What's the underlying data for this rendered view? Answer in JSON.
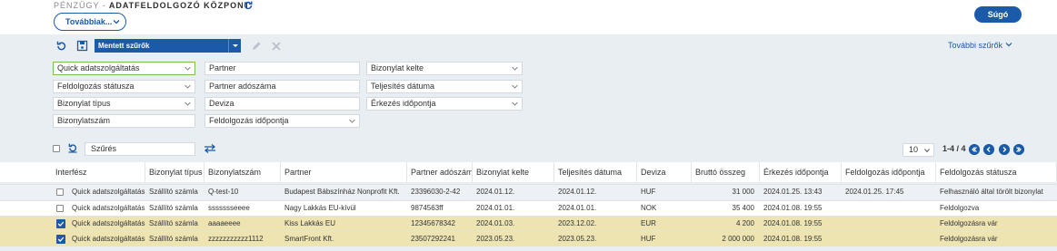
{
  "header": {
    "breadcrumb_section": "PÉNZÜGY -",
    "breadcrumb_page": "ADATFELDOLGOZÓ KÖZPONT",
    "more_button": "Továbbiak...",
    "help_button": "Súgó"
  },
  "filter_bar": {
    "saved_filter": "Mentett szűrők",
    "further_filters": "További szűrők"
  },
  "filters": {
    "quick": "Quick adatszolgáltatás",
    "processing_status": "Feldolgozás státusza",
    "doc_type": "Bizonylat típus",
    "doc_number": "Bizonylatszám",
    "partner": "Partner",
    "partner_tax": "Partner adószáma",
    "currency": "Deviza",
    "processing_time": "Feldolgozás időpontja",
    "doc_date": "Bizonylat kelte",
    "fulfil_date": "Teljesítés dátuma",
    "arrival_time": "Érkezés időpontja"
  },
  "table_toolbar": {
    "search_value": "Szűrés",
    "page_size": "10",
    "page_info": "1-4 / 4"
  },
  "columns": [
    "Interfész",
    "Bizonylat típus",
    "Bizonylatszám",
    "Partner",
    "Partner adószáma",
    "Bizonylat kelte",
    "Teljesítés dátuma",
    "Deviza",
    "Bruttó összeg",
    "Érkezés időpontja",
    "Feldolgozás időpontja",
    "Feldolgozás státusza"
  ],
  "rows": [
    {
      "checked": false,
      "interface": "Quick adatszolgáltatás",
      "type": "Szállító számla",
      "number": "Q-test-10",
      "partner": "Budapest Bábszínház Nonprofit Kft.",
      "tax": "23396030-2-42",
      "doc_date": "2024.01.12.",
      "fulfil": "2024.01.12.",
      "currency": "HUF",
      "gross": "31 000",
      "arrival": "2024.01.25. 13:43",
      "processed": "2024.01.25. 17:45",
      "status": "Felhasználó által törölt bizonylat"
    },
    {
      "checked": false,
      "interface": "Quick adatszolgáltatás",
      "type": "Szállító számla",
      "number": "ssssssseeee",
      "partner": "Nagy Lakkás EU-kívül",
      "tax": "9874563ff",
      "doc_date": "2024.01.01.",
      "fulfil": "2024.01.01.",
      "currency": "NOK",
      "gross": "35 400",
      "arrival": "2024.01.08. 19:55",
      "processed": "",
      "status": "Feldolgozva"
    },
    {
      "checked": true,
      "interface": "Quick adatszolgáltatás",
      "type": "Szállító számla",
      "number": "aaaaeeee",
      "partner": "Kiss Lakkás EU",
      "tax": "12345678342",
      "doc_date": "2024.01.03.",
      "fulfil": "2023.12.02.",
      "currency": "EUR",
      "gross": "4 200",
      "arrival": "2024.01.08. 19:55",
      "processed": "",
      "status": "Feldolgozásra vár"
    },
    {
      "checked": true,
      "interface": "Quick adatszolgáltatás",
      "type": "Szállító számla",
      "number": "zzzzzzzzzzz1112",
      "partner": "SmartFront Kft.",
      "tax": "23507292241",
      "doc_date": "2023.05.23.",
      "fulfil": "2023.05.23.",
      "currency": "HUF",
      "gross": "2 000 000",
      "arrival": "2024.01.08. 19:55",
      "processed": "",
      "status": "Feldolgozásra vár"
    }
  ]
}
